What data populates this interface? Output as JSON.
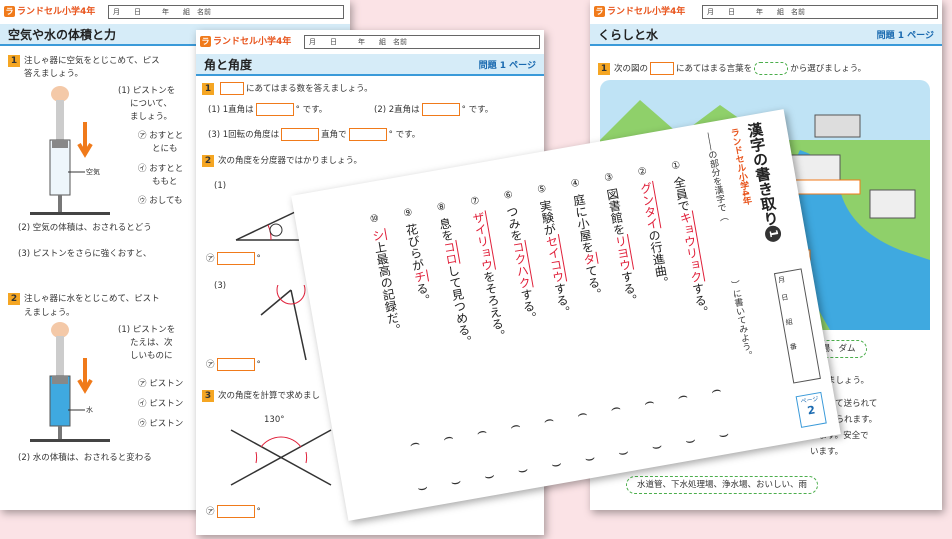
{
  "sheet_science": {
    "logo": "ランドセル小学4年",
    "name_fields": [
      "月",
      "日",
      "年",
      "組",
      "名前"
    ],
    "title": "空気や水の体積と力",
    "q1_num": "1",
    "q1_text1": "注しゃ器に空気をとじこめて、ピス",
    "q1_text2": "答えましょう。",
    "q1_sub1": "(1) ピストンを",
    "q1_sub1b": "について、",
    "q1_sub1c": "ましょう。",
    "q1_opt1": "㋐ おすとと",
    "q1_opt1b": "とにも",
    "q1_opt2": "㋑ おすとと",
    "q1_opt2b": "ももと",
    "q1_opt3": "㋒ おしても",
    "label_air": "空気",
    "q1_sub2": "(2) 空気の体積は、おされるとどう",
    "q1_sub3": "(3) ピストンをさらに強くおすと、",
    "q2_num": "2",
    "q2_text1": "注しゃ器に水をとじこめて、ピスト",
    "q2_text2": "えましょう。",
    "q2_sub1": "(1) ピストンを",
    "q2_sub1b": "たえは、次",
    "q2_sub1c": "しいものに",
    "q2_opt1": "㋐ ピストン",
    "q2_opt2": "㋑ ピストン",
    "q2_opt3": "㋒ ピストン",
    "label_water": "水",
    "q2_sub2": "(2) 水の体積は、おされると変わる"
  },
  "sheet_angle": {
    "logo": "ランドセル小学4年",
    "name_fields": [
      "月",
      "日",
      "年",
      "組",
      "名前"
    ],
    "title": "角と角度",
    "page_label": "問題 1 ページ",
    "q1_num": "1",
    "q1_text": "にあてはまる数を答えましょう。",
    "q1_a_pre": "(1) 1直角は",
    "q1_a_post": "° です。",
    "q1_b_pre": "(2) 2直角は",
    "q1_b_post": "° です。",
    "q1_c_pre": "(3) 1回転の角度は",
    "q1_c_mid": "直角で",
    "q1_c_post": "° です。",
    "q2_num": "2",
    "q2_text": "次の角度を分度器ではかりましょう。",
    "q2_1": "(1)",
    "q2_3": "(3)",
    "mark_a": "㋐",
    "degree": "°",
    "q3_num": "3",
    "q3_text": "次の角度を計算で求めまし",
    "angle_130": "130°",
    "mark_i": "㋑",
    "mark_u": "㋒"
  },
  "sheet_water": {
    "logo": "ランドセル小学4年",
    "name_fields": [
      "月",
      "日",
      "年",
      "組",
      "名前"
    ],
    "title": "くらしと水",
    "page_label": "問題 1 ページ",
    "q1_num": "1",
    "q1_text_a": "次の図の",
    "q1_text_b": "にあてはまる言葉を",
    "q1_text_c": "から選びましょう。",
    "word_box1": "、下水処理場、ダム",
    "line_select": "選びましょう。",
    "line_a": "を通って送られて",
    "line_b": "なく送られます。",
    "line_c": "います。安全で",
    "line_d": "います。",
    "word_box2": "水道管、下水処理場、浄水場、おいしい、雨"
  },
  "sheet_kanji": {
    "title_logo": "ランドセル小学4年",
    "title": "漢字の書き取り",
    "title_num": "1",
    "instr_a": "――の部分を漢字で（",
    "instr_b": "）に書いてみよう。",
    "meta_month": "月",
    "meta_day": "日",
    "meta_class": "組",
    "meta_num": "番",
    "page_label": "ページ",
    "page_num": "2",
    "items": [
      {
        "n": "①",
        "pre": "全員で",
        "red": "キョウリョク",
        "post": "する。"
      },
      {
        "n": "②",
        "pre": "",
        "red": "グンタイ",
        "post": "の行進曲。"
      },
      {
        "n": "③",
        "pre": "図書館を",
        "red": "リヨウ",
        "post": "する。"
      },
      {
        "n": "④",
        "pre": "庭に小屋を",
        "red": "タ",
        "post": "てる。"
      },
      {
        "n": "⑤",
        "pre": "実験が",
        "red": "セイコウ",
        "post": "する。"
      },
      {
        "n": "⑥",
        "pre": "つみを",
        "red": "コクハク",
        "post": "する。"
      },
      {
        "n": "⑦",
        "pre": "",
        "red": "ザイリョウ",
        "post": "をそろえる。"
      },
      {
        "n": "⑧",
        "pre": "息を",
        "red": "コロ",
        "post": "して見つめる。"
      },
      {
        "n": "⑨",
        "pre": "花びらが",
        "red": "チ",
        "post": "る。"
      },
      {
        "n": "⑩",
        "pre": "",
        "red": "シ",
        "post": "上最高の記録だ。"
      }
    ]
  },
  "colors": {
    "background": "#fbe3e6",
    "accent_orange": "#f07a1a",
    "accent_blue": "#3a9ad9",
    "red_text": "#e0203a"
  }
}
